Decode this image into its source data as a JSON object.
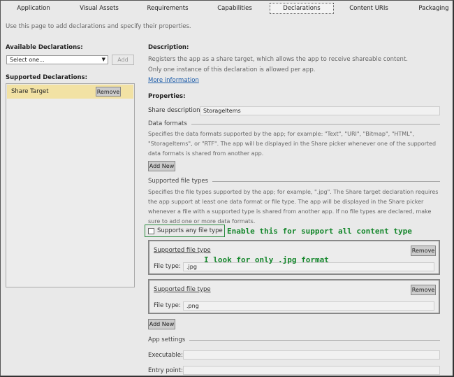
{
  "tabs": [
    "Application",
    "Visual Assets",
    "Requirements",
    "Capabilities",
    "Declarations",
    "Content URIs",
    "Packaging"
  ],
  "intro": "Use this page to add declarations and specify their properties.",
  "left": {
    "available_label": "Available Declarations:",
    "select_value": "Select one...",
    "add_label": "Add",
    "supported_label": "Supported Declarations:",
    "items": [
      {
        "label": "Share Target",
        "remove": "Remove"
      }
    ]
  },
  "right": {
    "description_label": "Description:",
    "description_lines": [
      "Registers the app as a share target, which allows the app to receive shareable content.",
      "Only one instance of this declaration is allowed per app."
    ],
    "more_info": "More information",
    "properties_label": "Properties:",
    "share_desc_label": "Share description:",
    "share_desc_value": "StorageItems",
    "data_formats_label": "Data formats",
    "data_formats_text": "Specifies the data formats supported by the app; for example: \"Text\", \"URI\", \"Bitmap\", \"HTML\", \"StorageItems\", or \"RTF\". The app will be displayed in the Share picker whenever one of the supported data formats is shared from another app.",
    "add_new": "Add New",
    "file_types_label": "Supported file types",
    "file_types_text": "Specifies the file types supported by the app; for example, \".jpg\". The Share target declaration requires the app support at least one data format or file type. The app will be displayed in the Share picker whenever a file with a supported type is shared from another app. If no file types are declared, make sure to add one or more data formats.",
    "supports_any": "Supports any file type",
    "file_type_entries": [
      {
        "title": "Supported file type",
        "remove": "Remove",
        "label": "File type:",
        "value": ".jpg"
      },
      {
        "title": "Supported file type",
        "remove": "Remove",
        "label": "File type:",
        "value": ".png"
      }
    ],
    "add_new_2": "Add New",
    "app_settings_label": "App settings",
    "executable_label": "Executable:",
    "entry_point_label": "Entry point:"
  },
  "annotations": {
    "any_type": "Enable this for support all content type",
    "jpg_only": "I look for only .jpg format"
  },
  "colors": {
    "annotation": "#15872c",
    "selected_item": "#f2e2a4"
  }
}
